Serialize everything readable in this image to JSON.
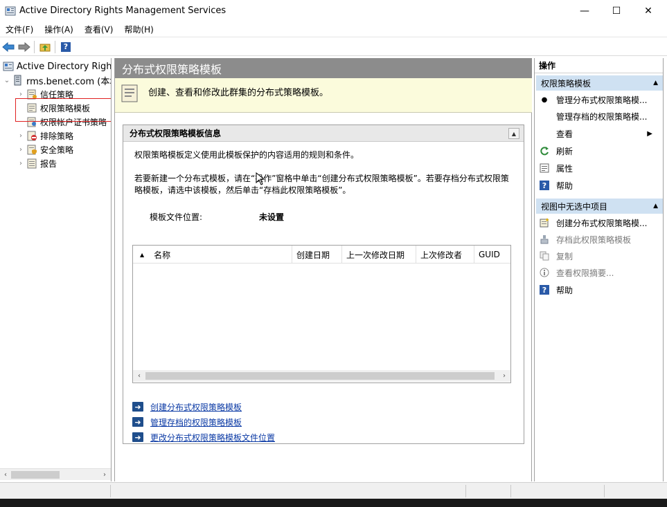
{
  "window": {
    "title": "Active Directory Rights Management Services",
    "minimize": "—",
    "maximize": "☐",
    "close": "✕"
  },
  "menu": {
    "items": [
      "文件(F)",
      "操作(A)",
      "查看(V)",
      "帮助(H)"
    ]
  },
  "toolbar": {
    "back": "back-icon",
    "forward": "forward-icon",
    "up": "folder-up-icon",
    "help": "?"
  },
  "tree": {
    "root": "Active Directory Rights",
    "server": "rms.benet.com (本地",
    "items": [
      {
        "label": "信任策略",
        "icon": "trust-policy-icon"
      },
      {
        "label": "权限策略模板",
        "icon": "template-icon",
        "selected": true
      },
      {
        "label": "权限帐户证书策略",
        "icon": "account-cert-icon"
      },
      {
        "label": "排除策略",
        "icon": "exclusion-icon"
      },
      {
        "label": "安全策略",
        "icon": "security-policy-icon"
      },
      {
        "label": "报告",
        "icon": "report-icon"
      }
    ]
  },
  "center": {
    "title": "分布式权限策略模板",
    "banner": "创建、查看和修改此群集的分布式策略模板。",
    "info_header": "分布式权限策略模板信息",
    "desc1": "权限策略模板定义使用此模板保护的内容适用的规则和条件。",
    "desc2": "若要新建一个分布式模板，请在“操作”窗格中单击“创建分布式权限策略模板”。若要存档分布式权限策略模板，请选中该模板，然后单击“存档此权限策略模板”。",
    "location_label": "模板文件位置:",
    "location_value": "未设置",
    "columns": [
      "名称",
      "创建日期",
      "上一次修改日期",
      "上次修改者",
      "GUID"
    ],
    "links": [
      "创建分布式权限策略模板",
      "管理存档的权限策略模板",
      "更改分布式权限策略模板文件位置"
    ]
  },
  "actions": {
    "title": "操作",
    "section1": "权限策略模板",
    "section1_items": [
      {
        "label": "管理分布式权限策略模...",
        "icon": "bullet-icon"
      },
      {
        "label": "管理存档的权限策略模...",
        "icon": ""
      },
      {
        "label": "查看",
        "icon": "",
        "submenu": true
      },
      {
        "label": "刷新",
        "icon": "refresh-icon"
      },
      {
        "label": "属性",
        "icon": "properties-icon"
      },
      {
        "label": "帮助",
        "icon": "help-icon"
      }
    ],
    "section2": "视图中无选中项目",
    "section2_items": [
      {
        "label": "创建分布式权限策略模...",
        "icon": "new-template-icon",
        "disabled": false
      },
      {
        "label": "存档此权限策略模板",
        "icon": "archive-icon",
        "disabled": true
      },
      {
        "label": "复制",
        "icon": "copy-icon",
        "disabled": true
      },
      {
        "label": "查看权限摘要...",
        "icon": "info-icon",
        "disabled": true
      },
      {
        "label": "帮助",
        "icon": "help-icon",
        "disabled": false
      }
    ]
  },
  "colors": {
    "center_title_bg": "#8c8c8c",
    "banner_bg": "#fbfbdc",
    "action_section_bg": "#cfe1f2",
    "link": "#0b3aa5",
    "selection_outline": "#e02020"
  }
}
